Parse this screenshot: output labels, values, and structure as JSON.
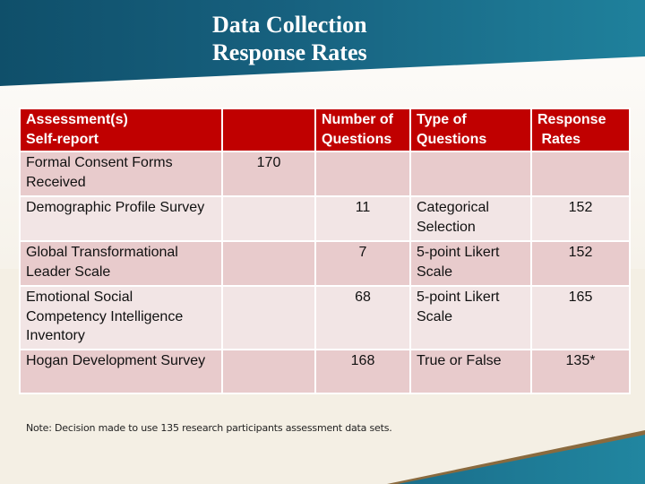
{
  "title": {
    "line1": "Data Collection",
    "line2": "Response Rates"
  },
  "table": {
    "headers": [
      {
        "line1": "Assessment(s)",
        "line2": "Self-report"
      },
      {
        "line1": "",
        "line2": ""
      },
      {
        "line1": "Number of",
        "line2": "Questions"
      },
      {
        "line1": "Type of",
        "line2": "Questions"
      },
      {
        "line1": "Response",
        "line2": " Rates"
      }
    ],
    "rows": [
      {
        "assessment": "Formal Consent Forms Received",
        "count": "170",
        "number_of_questions": "",
        "type_of_questions": "",
        "response_rate": ""
      },
      {
        "assessment": "Demographic Profile Survey",
        "count": "",
        "number_of_questions": "11",
        "type_of_questions": "Categorical Selection",
        "response_rate": "152"
      },
      {
        "assessment": "Global Transformational Leader Scale",
        "count": "",
        "number_of_questions": "7",
        "type_of_questions": "5-point Likert Scale",
        "response_rate": "152"
      },
      {
        "assessment": "Emotional Social Competency Intelligence Inventory",
        "count": "",
        "number_of_questions": "68",
        "type_of_questions": "5-point Likert Scale",
        "response_rate": "165"
      },
      {
        "assessment": "Hogan Development Survey",
        "count": "",
        "number_of_questions": "168",
        "type_of_questions": "True or False",
        "response_rate": "135*"
      }
    ]
  },
  "note": "Note: Decision made to use 135 research participants assessment data sets.",
  "colors": {
    "header_red": "#c00000",
    "row_dark": "#e8cbcc",
    "row_light": "#f2e5e5",
    "banner_teal": "#17617f",
    "background_cream": "#f4efe4"
  }
}
